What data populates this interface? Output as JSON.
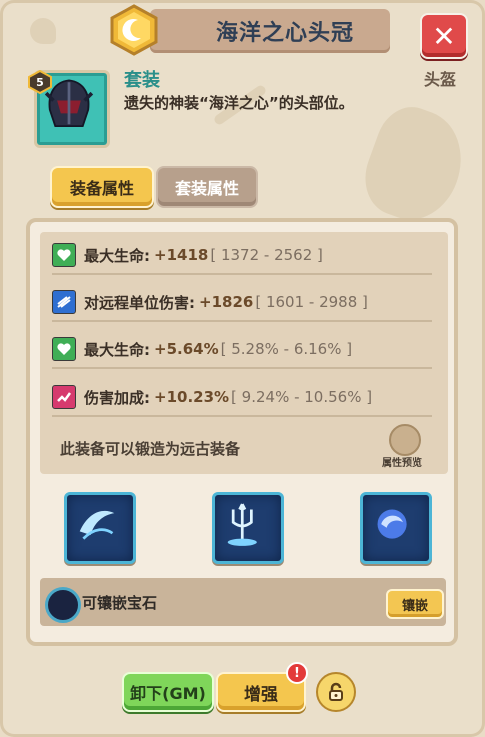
{
  "header": {
    "title": "海洋之心头冠",
    "slot_label": "头盔",
    "close_icon": "close-icon",
    "emblem_icon": "crescent-moon-emblem-icon"
  },
  "item": {
    "level": "5",
    "set_name": "套装",
    "description": "遗失的神装“海洋之心”的头部位。",
    "icon": "ocean-heart-helmet-icon"
  },
  "tabs": [
    {
      "label": "装备属性",
      "active": true
    },
    {
      "label": "套装属性",
      "active": false
    }
  ],
  "stats": [
    {
      "icon": "heart-shield-icon",
      "color": "#3fae56",
      "label": "最大生命:",
      "value": "+1418",
      "range": "[ 1372 - 2562 ]"
    },
    {
      "icon": "ranged-damage-icon",
      "color": "#2f6fd1",
      "label": "对远程单位伤害:",
      "value": "+1826",
      "range": "[ 1601 - 2988 ]"
    },
    {
      "icon": "heart-shield-icon",
      "color": "#3fae56",
      "label": "最大生命:",
      "value": "+5.64%",
      "range": "[ 5.28% - 6.16% ]"
    },
    {
      "icon": "damage-bonus-icon",
      "color": "#d63a6e",
      "label": "伤害加成:",
      "value": "+10.23%",
      "range": "[ 9.24% - 10.56% ]"
    }
  ],
  "forge": {
    "text": "此装备可以锻造为远古装备",
    "preview_label": "属性预览",
    "preview_icon": "scroll-preview-icon"
  },
  "skills": [
    {
      "icon": "wave-slash-skill-icon"
    },
    {
      "icon": "trident-skill-icon"
    },
    {
      "icon": "water-orb-skill-icon"
    }
  ],
  "gem": {
    "text": "可镶嵌宝石",
    "inlay_label": "镶嵌"
  },
  "actions": {
    "unequip_label": "卸下(GM)",
    "enhance_label": "增强",
    "alert": "!",
    "lock_icon": "padlock-icon"
  }
}
